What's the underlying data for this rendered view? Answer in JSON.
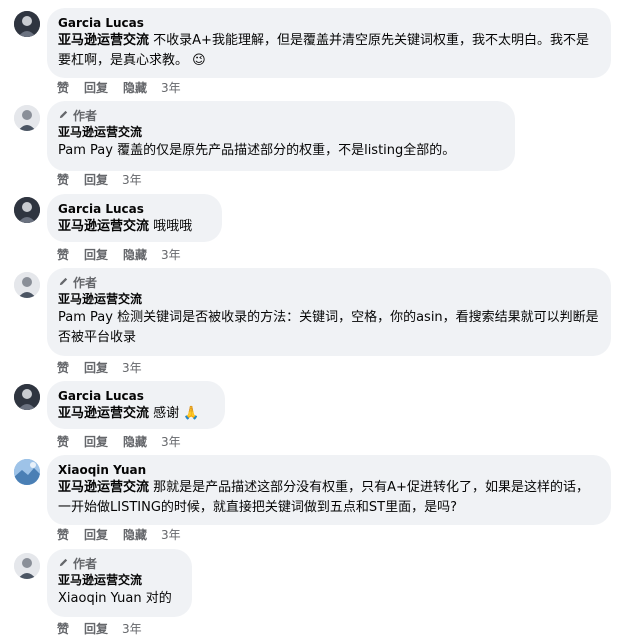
{
  "comments": [
    {
      "author": "Garcia Lucas",
      "page": "亚马逊运营交流",
      "text": "不收录A+我能理解，但是覆盖并清空原先关键词权重，我不太明白。我不是要杠啊，是真心求教。",
      "emoji": "😉",
      "actions": {
        "like": "赞",
        "reply": "回复",
        "hide": "隐藏",
        "time": "3年"
      }
    },
    {
      "badge": "作者",
      "page": "亚马逊运营交流",
      "mention": "Pam Pay",
      "text": "覆盖的仅是原先产品描述部分的权重，不是listing全部的。",
      "actions": {
        "like": "赞",
        "reply": "回复",
        "hide": "隐藏",
        "time": "3年"
      }
    },
    {
      "author": "Garcia Lucas",
      "page": "亚马逊运营交流",
      "text": "哦哦哦",
      "actions": {
        "like": "赞",
        "reply": "回复",
        "hide": "隐藏",
        "time": "3年"
      }
    },
    {
      "badge": "作者",
      "page": "亚马逊运营交流",
      "mention": "Pam Pay",
      "text": "检测关键词是否被收录的方法：关键词，空格，你的asin，看搜索结果就可以判断是否被平台收录",
      "actions": {
        "like": "赞",
        "reply": "回复",
        "hide": "隐藏",
        "time": "3年"
      }
    },
    {
      "author": "Garcia Lucas",
      "page": "亚马逊运营交流",
      "text": "感谢",
      "emoji": "🙏",
      "actions": {
        "like": "赞",
        "reply": "回复",
        "hide": "隐藏",
        "time": "3年"
      }
    },
    {
      "author": "Xiaoqin Yuan",
      "page": "亚马逊运营交流",
      "text": "那就是是产品描述这部分没有权重，只有A+促进转化了，如果是这样的话，一开始做LISTING的时候，就直接把关键词做到五点和ST里面，是吗?",
      "actions": {
        "like": "赞",
        "reply": "回复",
        "hide": "隐藏",
        "time": "3年"
      }
    },
    {
      "badge": "作者",
      "page": "亚马逊运营交流",
      "mention": "Xiaoqin Yuan",
      "text": "对的",
      "actions": {
        "like": "赞",
        "reply": "回复",
        "hide": "隐藏",
        "time": "3年"
      }
    }
  ],
  "colors": {
    "bubble": "#f0f2f5",
    "muted": "#65676b",
    "text": "#050505"
  },
  "icons": {
    "badge_icon": "pencil-icon"
  }
}
